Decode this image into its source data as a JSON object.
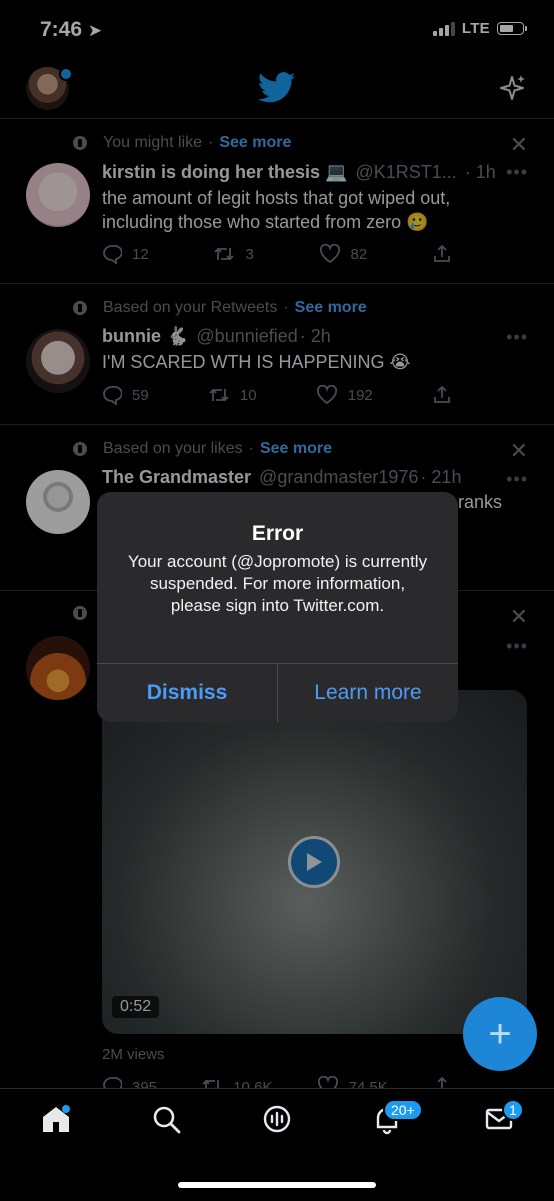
{
  "status_bar": {
    "time": "7:46",
    "network": "LTE"
  },
  "header": {
    "logo": "twitter-bird-icon",
    "sparkle": "sparkle-icon"
  },
  "tweets": [
    {
      "context": "You might like",
      "see_more": "See more",
      "name": "kirstin is doing her thesis 💻",
      "handle": "@K1RST1...",
      "time": "· 1h",
      "text": "the amount of legit hosts that got wiped out, including those who started from zero 🥲",
      "replies": "12",
      "retweets": "3",
      "likes": "82"
    },
    {
      "context": "Based on your Retweets",
      "see_more": "See more",
      "name": "bunnie 🐇",
      "handle": "@bunniefied",
      "time": "· 2h",
      "text": "I'M SCARED WTH IS HAPPENING 😭",
      "replies": "59",
      "retweets": "10",
      "likes": "192"
    },
    {
      "context": "Based on your likes",
      "see_more": "See more",
      "name": "The Grandmaster",
      "handle": "@grandmaster1976",
      "time": "· 21h",
      "text_fragment": "ranks"
    },
    {
      "video_duration": "0:52",
      "views": "2M views",
      "replies": "395",
      "retweets": "10.6K",
      "likes": "74.5K"
    }
  ],
  "dialog": {
    "title": "Error",
    "message": "Your account (@Jopromote) is currently suspended. For more information, please sign into Twitter.com.",
    "dismiss": "Dismiss",
    "learn_more": "Learn more"
  },
  "fab": {
    "label": "+"
  },
  "bottom_nav": {
    "items": [
      "home-icon",
      "search-icon",
      "spaces-icon",
      "notifications-icon",
      "messages-icon"
    ],
    "notifications_badge": "20+",
    "messages_badge": "1"
  },
  "colors": {
    "accent": "#1d9bf0",
    "link": "#4ea1f2",
    "muted": "#71767b",
    "dialog_bg": "#2a2a2c"
  }
}
